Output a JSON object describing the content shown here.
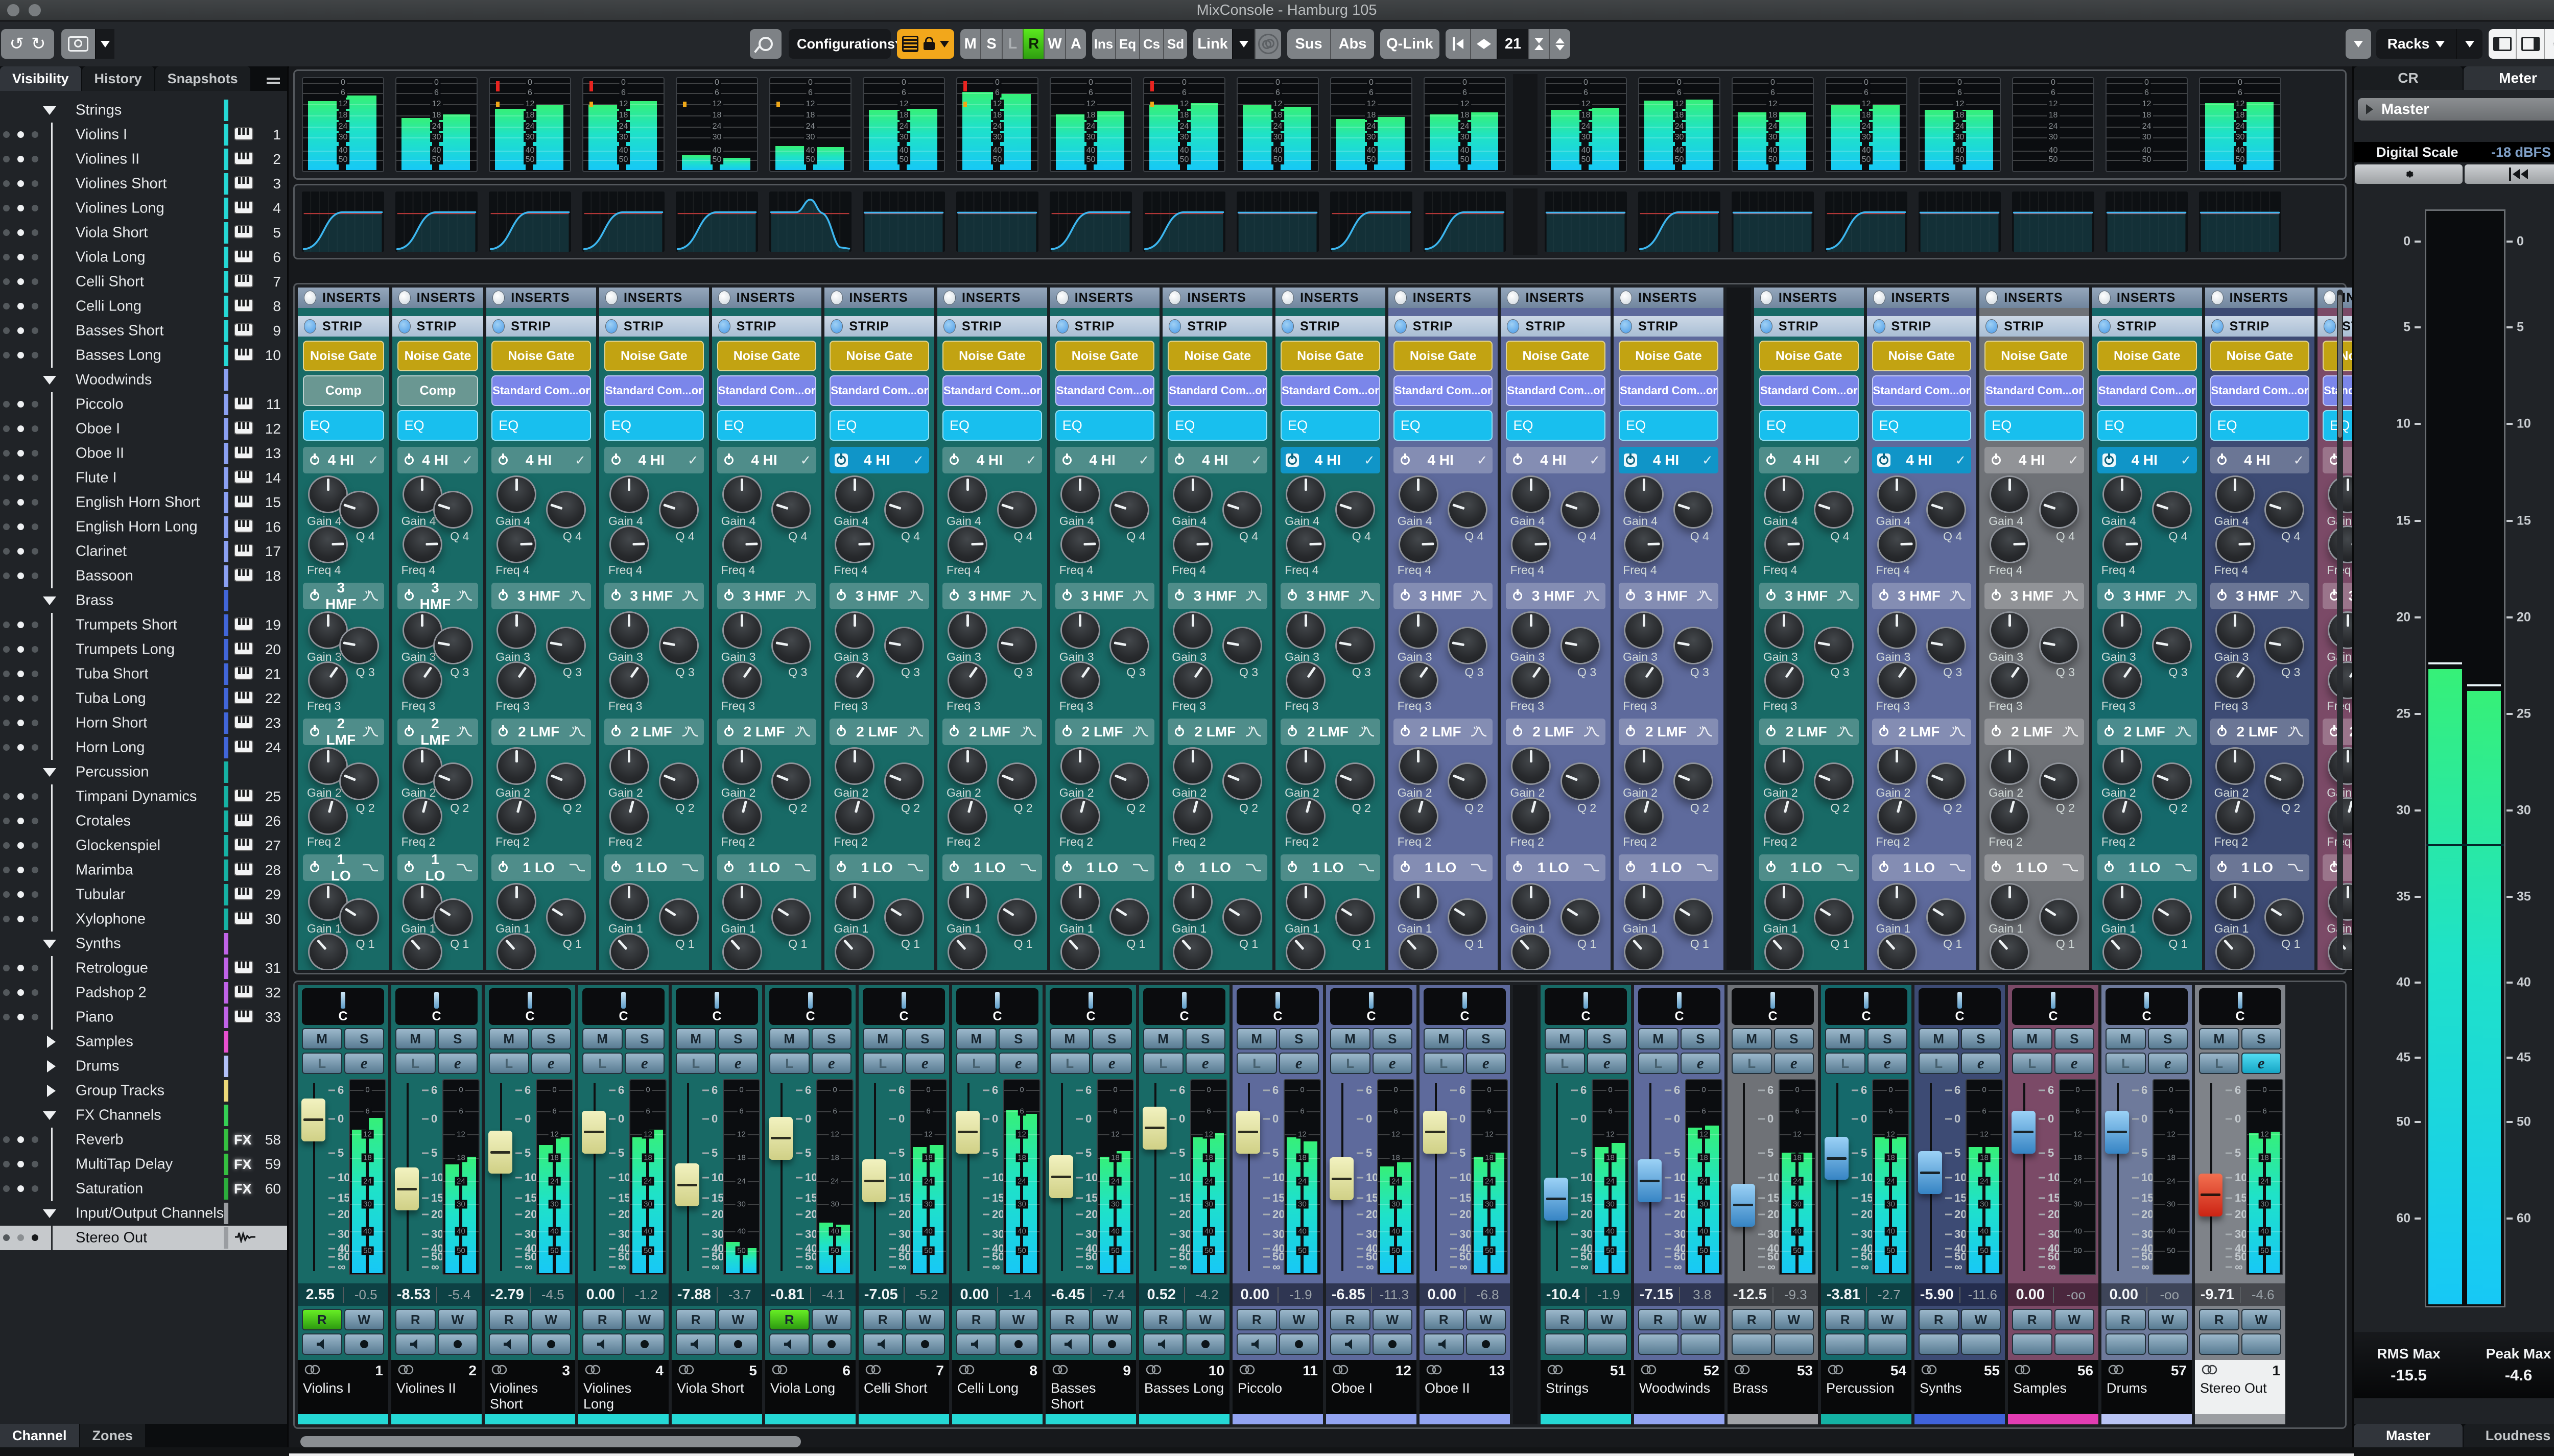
{
  "window": {
    "title": "MixConsole - Hamburg 105"
  },
  "toolbar": {
    "configurations_label": "Configurations",
    "channel_buttons": [
      "M",
      "S",
      "L",
      "R",
      "W",
      "A"
    ],
    "active_channel_button": "R",
    "rack_buttons": [
      "Ins",
      "Eq",
      "Cs",
      "Sd"
    ],
    "link_label": "Link",
    "sus_label": "Sus",
    "abs_label": "Abs",
    "qlink_label": "Q-Link",
    "width_value": "21",
    "racks_label": "Racks"
  },
  "sidebar": {
    "tabs": [
      "Visibility",
      "History",
      "Snapshots"
    ],
    "active_tab": "Visibility",
    "bottom_tabs": [
      "Channel",
      "Zones"
    ],
    "active_bottom_tab": "Channel",
    "items": [
      {
        "label": "Strings",
        "kind": "group",
        "color": "#25d8d5"
      },
      {
        "label": "Violins I",
        "kind": "child",
        "num": "1",
        "badge": "piano",
        "color": "#25d8d5"
      },
      {
        "label": "Violines II",
        "kind": "child",
        "num": "2",
        "badge": "piano",
        "color": "#25d8d5"
      },
      {
        "label": "Violines Short",
        "kind": "child",
        "num": "3",
        "badge": "piano",
        "color": "#25d8d5"
      },
      {
        "label": "Violines Long",
        "kind": "child",
        "num": "4",
        "badge": "piano",
        "color": "#25d8d5"
      },
      {
        "label": "Viola Short",
        "kind": "child",
        "num": "5",
        "badge": "piano",
        "color": "#25d8d5"
      },
      {
        "label": "Viola Long",
        "kind": "child",
        "num": "6",
        "badge": "piano",
        "color": "#25d8d5"
      },
      {
        "label": "Celli Short",
        "kind": "child",
        "num": "7",
        "badge": "piano",
        "color": "#25d8d5"
      },
      {
        "label": "Celli Long",
        "kind": "child",
        "num": "8",
        "badge": "piano",
        "color": "#25d8d5"
      },
      {
        "label": "Basses Short",
        "kind": "child",
        "num": "9",
        "badge": "piano",
        "color": "#25d8d5"
      },
      {
        "label": "Basses Long",
        "kind": "child",
        "num": "10",
        "badge": "piano",
        "color": "#25d8d5"
      },
      {
        "label": "Woodwinds",
        "kind": "group",
        "color": "#8ba0f2"
      },
      {
        "label": "Piccolo",
        "kind": "child",
        "num": "11",
        "badge": "piano",
        "color": "#8ba0f2"
      },
      {
        "label": "Oboe I",
        "kind": "child",
        "num": "12",
        "badge": "piano",
        "color": "#8ba0f2"
      },
      {
        "label": "Oboe II",
        "kind": "child",
        "num": "13",
        "badge": "piano",
        "color": "#8ba0f2"
      },
      {
        "label": "Flute I",
        "kind": "child",
        "num": "14",
        "badge": "piano",
        "color": "#8ba0f2"
      },
      {
        "label": "English Horn Short",
        "kind": "child",
        "num": "15",
        "badge": "piano",
        "color": "#8ba0f2"
      },
      {
        "label": "English Horn Long",
        "kind": "child",
        "num": "16",
        "badge": "piano",
        "color": "#8ba0f2"
      },
      {
        "label": "Clarinet",
        "kind": "child",
        "num": "17",
        "badge": "piano",
        "color": "#8ba0f2"
      },
      {
        "label": "Bassoon",
        "kind": "child",
        "num": "18",
        "badge": "piano",
        "color": "#8ba0f2"
      },
      {
        "label": "Brass",
        "kind": "group",
        "color": "#4166d9"
      },
      {
        "label": "Trumpets Short",
        "kind": "child",
        "num": "19",
        "badge": "piano",
        "color": "#4166d9"
      },
      {
        "label": "Trumpets Long",
        "kind": "child",
        "num": "20",
        "badge": "piano",
        "color": "#4166d9"
      },
      {
        "label": "Tuba Short",
        "kind": "child",
        "num": "21",
        "badge": "piano",
        "color": "#4166d9"
      },
      {
        "label": "Tuba Long",
        "kind": "child",
        "num": "22",
        "badge": "piano",
        "color": "#4166d9"
      },
      {
        "label": "Horn Short",
        "kind": "child",
        "num": "23",
        "badge": "piano",
        "color": "#4166d9"
      },
      {
        "label": "Horn Long",
        "kind": "child",
        "num": "24",
        "badge": "piano",
        "color": "#4166d9"
      },
      {
        "label": "Percussion",
        "kind": "group",
        "color": "#16b2a4"
      },
      {
        "label": "Timpani Dynamics",
        "kind": "child",
        "num": "25",
        "badge": "piano",
        "color": "#16b2a4"
      },
      {
        "label": "Crotales",
        "kind": "child",
        "num": "26",
        "badge": "piano",
        "color": "#16b2a4"
      },
      {
        "label": "Glockenspiel",
        "kind": "child",
        "num": "27",
        "badge": "piano",
        "color": "#16b2a4"
      },
      {
        "label": "Marimba",
        "kind": "child",
        "num": "28",
        "badge": "piano",
        "color": "#16b2a4"
      },
      {
        "label": "Tubular",
        "kind": "child",
        "num": "29",
        "badge": "piano",
        "color": "#16b2a4"
      },
      {
        "label": "Xylophone",
        "kind": "child",
        "num": "30",
        "badge": "piano",
        "color": "#16b2a4"
      },
      {
        "label": "Synths",
        "kind": "group",
        "color": "#c063e8"
      },
      {
        "label": "Retrologue",
        "kind": "child",
        "num": "31",
        "badge": "piano",
        "color": "#c063e8"
      },
      {
        "label": "Padshop 2",
        "kind": "child",
        "num": "32",
        "badge": "piano",
        "color": "#c063e8"
      },
      {
        "label": "Piano",
        "kind": "child",
        "num": "33",
        "badge": "piano",
        "color": "#c063e8"
      },
      {
        "label": "Samples",
        "kind": "groupc",
        "color": "#e850d0"
      },
      {
        "label": "Drums",
        "kind": "groupc",
        "color": "#b2c0f8"
      },
      {
        "label": "Group Tracks",
        "kind": "groupc",
        "color": "#ecd979"
      },
      {
        "label": "FX Channels",
        "kind": "group",
        "color": "#35d054"
      },
      {
        "label": "Reverb",
        "kind": "child",
        "num": "58",
        "badge": "fx",
        "color": "#35c040"
      },
      {
        "label": "MultiTap Delay",
        "kind": "child",
        "num": "59",
        "badge": "fx",
        "color": "#35c040"
      },
      {
        "label": "Saturation",
        "kind": "child",
        "num": "60",
        "badge": "fx",
        "color": "#2cae3c"
      },
      {
        "label": "Input/Output Channels",
        "kind": "group",
        "color": "#9a9da1"
      },
      {
        "label": "Stereo Out",
        "kind": "child",
        "badge": "wave",
        "color": "#9a9da1",
        "selected": true
      }
    ]
  },
  "right_panel": {
    "tabs": [
      "CR",
      "Meter"
    ],
    "active_tab": "Meter",
    "master_label": "Master",
    "digital_scale_label": "Digital Scale",
    "digital_scale_value": "-18 dBFS",
    "meter_scale": [
      [
        "0",
        3
      ],
      [
        "5",
        11
      ],
      [
        "10",
        20
      ],
      [
        "15",
        29
      ],
      [
        "20",
        38
      ],
      [
        "25",
        47
      ],
      [
        "30",
        56
      ],
      [
        "35",
        64
      ],
      [
        "40",
        72
      ],
      [
        "45",
        79
      ],
      [
        "50",
        85
      ],
      [
        "60",
        94
      ]
    ],
    "meter_l": 58,
    "meter_r": 56,
    "rms_label": "RMS Max",
    "rms_value": "-15.5",
    "peak_label": "Peak Max",
    "peak_value": "-4.6",
    "bottom_tabs": [
      "Master",
      "Loudness"
    ],
    "active_bottom_tab": "Master"
  },
  "mixer": {
    "inserts_label": "INSERTS",
    "strip_label": "STRIP",
    "eq_slot_label": "EQ",
    "noise_gate_label": "Noise Gate",
    "gate_label": "Gate",
    "comp_short_label": "Comp",
    "comp_standard_label": "Standard Com...or",
    "eq_bands": [
      {
        "name": "4 HI",
        "icon": "check"
      },
      {
        "name": "3 HMF",
        "icon": "bell"
      },
      {
        "name": "2 LMF",
        "icon": "bell"
      },
      {
        "name": "1 LO",
        "icon": "shelf"
      }
    ],
    "knob_prefixes": [
      "Gain",
      "Freq",
      "Q"
    ],
    "pan_label": "C",
    "ms_buttons": [
      "M",
      "S"
    ],
    "le_buttons": [
      "L",
      "e"
    ],
    "rw_buttons": [
      "R",
      "W"
    ],
    "fader_scale": [
      [
        "6",
        7
      ],
      [
        "0",
        21
      ],
      [
        "5",
        38
      ],
      [
        "10",
        50
      ],
      [
        "15",
        60
      ],
      [
        "20",
        68
      ],
      [
        "30",
        78
      ],
      [
        "40",
        85
      ],
      [
        "50",
        89
      ],
      [
        "∞",
        94
      ]
    ],
    "meter_marks": [
      [
        "0",
        5
      ],
      [
        "6",
        16
      ],
      [
        "12",
        28
      ],
      [
        "18",
        40
      ],
      [
        "24",
        52
      ],
      [
        "30",
        64
      ],
      [
        "40",
        78
      ],
      [
        "50",
        88
      ]
    ],
    "channels_left": [
      {
        "num": "1",
        "name": "Violins I",
        "family": "strings",
        "db": "2.55",
        "peak": "-0.5",
        "fader": 16,
        "cap": "yellow",
        "meter_l": 74,
        "meter_r": 80,
        "curve": "rise",
        "clip": "",
        "hi": false,
        "r_on": true,
        "comp": "comp"
      },
      {
        "num": "2",
        "name": "Violines II",
        "family": "strings",
        "db": "-8.53",
        "peak": "-5.4",
        "fader": 50,
        "cap": "yellow",
        "meter_l": 56,
        "meter_r": 60,
        "curve": "rise",
        "clip": "",
        "hi": false,
        "r_on": false,
        "comp": "comp"
      },
      {
        "num": "3",
        "name": "Violines Short",
        "family": "strings",
        "db": "-2.79",
        "peak": "-4.5",
        "fader": 32,
        "cap": "yellow",
        "meter_l": 66,
        "meter_r": 70,
        "curve": "rise",
        "clip": "red",
        "hi": false,
        "r_on": false,
        "comp": "std"
      },
      {
        "num": "4",
        "name": "Violines Long",
        "family": "strings",
        "db": "0.00",
        "peak": "-1.2",
        "fader": 22,
        "cap": "yellow",
        "meter_l": 70,
        "meter_r": 74,
        "curve": "rise",
        "clip": "red",
        "hi": false,
        "r_on": false,
        "comp": "std"
      },
      {
        "num": "5",
        "name": "Viola Short",
        "family": "strings",
        "db": "-7.88",
        "peak": "-3.7",
        "fader": 48,
        "cap": "yellow",
        "meter_l": 16,
        "meter_r": 13,
        "curve": "rise",
        "clip": "orange",
        "hi": false,
        "r_on": false,
        "comp": "std"
      },
      {
        "num": "6",
        "name": "Viola Long",
        "family": "strings",
        "db": "-0.81",
        "peak": "-4.1",
        "fader": 25,
        "cap": "yellow",
        "meter_l": 26,
        "meter_r": 25,
        "curve": "bump",
        "clip": "orange",
        "hi": true,
        "r_on": true,
        "comp": "std"
      },
      {
        "num": "7",
        "name": "Celli Short",
        "family": "strings",
        "db": "-7.05",
        "peak": "-5.2",
        "fader": 46,
        "cap": "yellow",
        "meter_l": 65,
        "meter_r": 66,
        "curve": "flat",
        "clip": "",
        "hi": false,
        "r_on": false,
        "comp": "std"
      },
      {
        "num": "8",
        "name": "Celli Long",
        "family": "strings",
        "db": "0.00",
        "peak": "-1.4",
        "fader": 22,
        "cap": "yellow",
        "meter_l": 84,
        "meter_r": 82,
        "curve": "flat",
        "clip": "red",
        "hi": false,
        "r_on": false,
        "comp": "std"
      },
      {
        "num": "9",
        "name": "Basses Short",
        "family": "strings",
        "db": "-6.45",
        "peak": "-7.4",
        "fader": 44,
        "cap": "yellow",
        "meter_l": 60,
        "meter_r": 63,
        "curve": "rise",
        "clip": "",
        "hi": false,
        "r_on": false,
        "comp": "std"
      },
      {
        "num": "10",
        "name": "Basses Long",
        "family": "strings",
        "db": "0.52",
        "peak": "-4.2",
        "fader": 20,
        "cap": "yellow",
        "meter_l": 70,
        "meter_r": 72,
        "curve": "rise",
        "clip": "red",
        "hi": true,
        "r_on": false,
        "comp": "std"
      },
      {
        "num": "11",
        "name": "Piccolo",
        "family": "woodwinds",
        "db": "0.00",
        "peak": "-1.9",
        "fader": 22,
        "cap": "yellow",
        "meter_l": 70,
        "meter_r": 68,
        "curve": "flat",
        "clip": "",
        "hi": false,
        "r_on": false,
        "comp": "std"
      },
      {
        "num": "12",
        "name": "Oboe I",
        "family": "woodwinds",
        "db": "-6.85",
        "peak": "-11.3",
        "fader": 45,
        "cap": "yellow",
        "meter_l": 55,
        "meter_r": 57,
        "curve": "rise",
        "clip": "",
        "hi": false,
        "r_on": false,
        "comp": "std"
      },
      {
        "num": "13",
        "name": "Oboe II",
        "family": "woodwinds",
        "db": "0.00",
        "peak": "-6.8",
        "fader": 22,
        "cap": "yellow",
        "meter_l": 60,
        "meter_r": 62,
        "curve": "rise",
        "clip": "",
        "hi": true,
        "r_on": false,
        "comp": "std"
      }
    ],
    "channels_right": [
      {
        "num": "51",
        "name": "Strings",
        "family": "strings",
        "db": "-10.4",
        "peak": "-1.9",
        "fader": 55,
        "cap": "blue",
        "meter_l": 65,
        "meter_r": 67,
        "curve": "flat",
        "clip": "",
        "hi": false,
        "r_on": false,
        "comp": "std"
      },
      {
        "num": "52",
        "name": "Woodwinds",
        "family": "woodwinds",
        "db": "-7.15",
        "peak": "3.8",
        "fader": 46,
        "cap": "blue",
        "meter_l": 75,
        "meter_r": 76,
        "curve": "rise",
        "clip": "",
        "hi": true,
        "r_on": false,
        "comp": "std"
      },
      {
        "num": "53",
        "name": "Brass",
        "family": "brass",
        "db": "-12.5",
        "peak": "-9.3",
        "fader": 58,
        "cap": "blue",
        "meter_l": 62,
        "meter_r": 62,
        "curve": "flat",
        "clip": "",
        "hi": false,
        "r_on": false,
        "comp": "std"
      },
      {
        "num": "54",
        "name": "Percussion",
        "family": "percussion",
        "db": "-3.81",
        "peak": "-2.7",
        "fader": 35,
        "cap": "blue",
        "meter_l": 70,
        "meter_r": 70,
        "curve": "rise",
        "clip": "",
        "hi": true,
        "r_on": false,
        "comp": "std"
      },
      {
        "num": "55",
        "name": "Synths",
        "family": "synths",
        "db": "-5.90",
        "peak": "-11.6",
        "fader": 42,
        "cap": "blue",
        "meter_l": 65,
        "meter_r": 65,
        "curve": "flat",
        "clip": "",
        "hi": false,
        "r_on": false,
        "comp": "std"
      },
      {
        "num": "56",
        "name": "Samples",
        "family": "samples",
        "db": "0.00",
        "peak": "-oo",
        "fader": 22,
        "cap": "blue",
        "meter_l": 0,
        "meter_r": 0,
        "curve": "flat",
        "clip": "",
        "hi": false,
        "r_on": false,
        "comp": "std"
      },
      {
        "num": "57",
        "name": "Drums",
        "family": "drums",
        "db": "0.00",
        "peak": "-oo",
        "fader": 22,
        "cap": "blue",
        "meter_l": 0,
        "meter_r": 0,
        "curve": "flat",
        "clip": "",
        "hi": false,
        "r_on": false,
        "comp": "std"
      },
      {
        "num": "1",
        "name": "Stereo Out",
        "family": "output",
        "db": "-9.71",
        "peak": "-4.6",
        "fader": 53,
        "cap": "red",
        "meter_l": 72,
        "meter_r": 73,
        "curve": "flat",
        "clip": "",
        "hi": false,
        "r_on": false,
        "comp": "gray",
        "gate": "gray",
        "e_on": true,
        "selected": true
      }
    ]
  },
  "palette": {
    "strings": {
      "body": "#186a66",
      "dark": "#0d4144",
      "bar": "#25d8d5"
    },
    "woodwinds": {
      "body": "#5e6a9c",
      "dark": "#2f3652",
      "bar": "#93a4f2"
    },
    "brass": {
      "body": "#6f7277",
      "dark": "#3c3f44",
      "bar": "#a0a2a6"
    },
    "percussion": {
      "body": "#15696b",
      "dark": "#0d4144",
      "bar": "#14b2a4"
    },
    "synths": {
      "body": "#3d4b74",
      "dark": "#242d4e",
      "bar": "#4063da"
    },
    "samples": {
      "body": "#7b4a67",
      "dark": "#4a273d",
      "bar": "#e23db3"
    },
    "drums": {
      "body": "#6e7a9b",
      "dark": "#3e4559",
      "bar": "#b9c4f4"
    },
    "output": {
      "body": "#7f8389",
      "dark": "#47494e",
      "bar": "#9b9ea2"
    }
  }
}
